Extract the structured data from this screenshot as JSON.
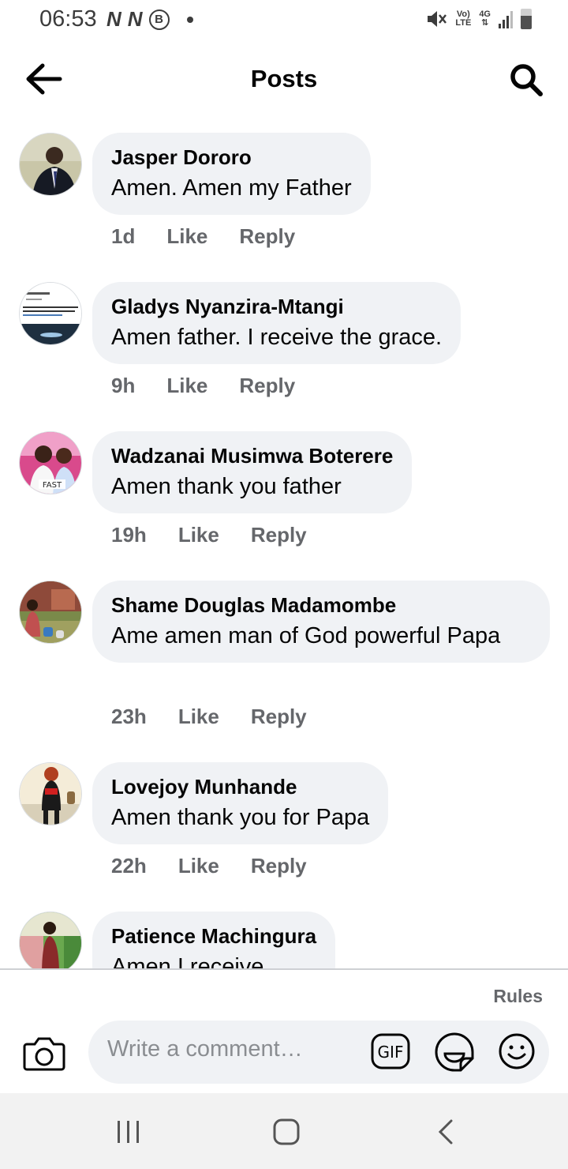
{
  "status_bar": {
    "time": "06:53",
    "left_icons": [
      "N",
      "N",
      "B"
    ],
    "volte": "Vo)",
    "lte": "LTE",
    "net": "4G"
  },
  "header": {
    "title": "Posts"
  },
  "comments": [
    {
      "name": "Jasper Dororo",
      "text": "Amen.  Amen my Father",
      "time": "1d",
      "like": "Like",
      "reply": "Reply"
    },
    {
      "name": "Gladys Nyanzira-Mtangi",
      "text": "Amen father. I receive the grace.",
      "time": "9h",
      "like": "Like",
      "reply": "Reply"
    },
    {
      "name": "Wadzanai Musimwa Boterere",
      "text": "Amen thank you father",
      "time": "19h",
      "like": "Like",
      "reply": "Reply",
      "avatar_caption": "FAST"
    },
    {
      "name": "Shame Douglas Madamombe",
      "text": "Ame amen man of God powerful Papa",
      "time": "23h",
      "like": "Like",
      "reply": "Reply"
    },
    {
      "name": "Lovejoy Munhande",
      "text": "Amen thank you for Papa",
      "time": "22h",
      "like": "Like",
      "reply": "Reply"
    },
    {
      "name": "Patience Machingura",
      "text": "Amen I receive",
      "time": "",
      "like": "",
      "reply": ""
    }
  ],
  "composer": {
    "rules": "Rules",
    "placeholder": "Write a comment…",
    "gif": "GIF"
  },
  "colors": {
    "bubble": "#f0f2f5",
    "meta": "#65676b",
    "text": "#050505"
  }
}
